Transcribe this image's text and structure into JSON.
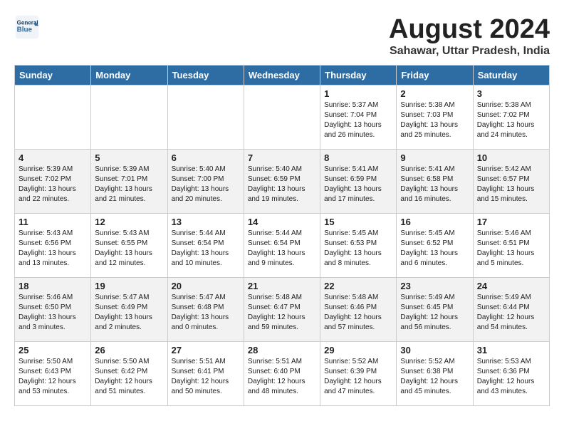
{
  "header": {
    "logo_line1": "General",
    "logo_line2": "Blue",
    "title": "August 2024",
    "subtitle": "Sahawar, Uttar Pradesh, India"
  },
  "days_of_week": [
    "Sunday",
    "Monday",
    "Tuesday",
    "Wednesday",
    "Thursday",
    "Friday",
    "Saturday"
  ],
  "weeks": [
    [
      {
        "day": "",
        "info": ""
      },
      {
        "day": "",
        "info": ""
      },
      {
        "day": "",
        "info": ""
      },
      {
        "day": "",
        "info": ""
      },
      {
        "day": "1",
        "info": "Sunrise: 5:37 AM\nSunset: 7:04 PM\nDaylight: 13 hours\nand 26 minutes."
      },
      {
        "day": "2",
        "info": "Sunrise: 5:38 AM\nSunset: 7:03 PM\nDaylight: 13 hours\nand 25 minutes."
      },
      {
        "day": "3",
        "info": "Sunrise: 5:38 AM\nSunset: 7:02 PM\nDaylight: 13 hours\nand 24 minutes."
      }
    ],
    [
      {
        "day": "4",
        "info": "Sunrise: 5:39 AM\nSunset: 7:02 PM\nDaylight: 13 hours\nand 22 minutes."
      },
      {
        "day": "5",
        "info": "Sunrise: 5:39 AM\nSunset: 7:01 PM\nDaylight: 13 hours\nand 21 minutes."
      },
      {
        "day": "6",
        "info": "Sunrise: 5:40 AM\nSunset: 7:00 PM\nDaylight: 13 hours\nand 20 minutes."
      },
      {
        "day": "7",
        "info": "Sunrise: 5:40 AM\nSunset: 6:59 PM\nDaylight: 13 hours\nand 19 minutes."
      },
      {
        "day": "8",
        "info": "Sunrise: 5:41 AM\nSunset: 6:59 PM\nDaylight: 13 hours\nand 17 minutes."
      },
      {
        "day": "9",
        "info": "Sunrise: 5:41 AM\nSunset: 6:58 PM\nDaylight: 13 hours\nand 16 minutes."
      },
      {
        "day": "10",
        "info": "Sunrise: 5:42 AM\nSunset: 6:57 PM\nDaylight: 13 hours\nand 15 minutes."
      }
    ],
    [
      {
        "day": "11",
        "info": "Sunrise: 5:43 AM\nSunset: 6:56 PM\nDaylight: 13 hours\nand 13 minutes."
      },
      {
        "day": "12",
        "info": "Sunrise: 5:43 AM\nSunset: 6:55 PM\nDaylight: 13 hours\nand 12 minutes."
      },
      {
        "day": "13",
        "info": "Sunrise: 5:44 AM\nSunset: 6:54 PM\nDaylight: 13 hours\nand 10 minutes."
      },
      {
        "day": "14",
        "info": "Sunrise: 5:44 AM\nSunset: 6:54 PM\nDaylight: 13 hours\nand 9 minutes."
      },
      {
        "day": "15",
        "info": "Sunrise: 5:45 AM\nSunset: 6:53 PM\nDaylight: 13 hours\nand 8 minutes."
      },
      {
        "day": "16",
        "info": "Sunrise: 5:45 AM\nSunset: 6:52 PM\nDaylight: 13 hours\nand 6 minutes."
      },
      {
        "day": "17",
        "info": "Sunrise: 5:46 AM\nSunset: 6:51 PM\nDaylight: 13 hours\nand 5 minutes."
      }
    ],
    [
      {
        "day": "18",
        "info": "Sunrise: 5:46 AM\nSunset: 6:50 PM\nDaylight: 13 hours\nand 3 minutes."
      },
      {
        "day": "19",
        "info": "Sunrise: 5:47 AM\nSunset: 6:49 PM\nDaylight: 13 hours\nand 2 minutes."
      },
      {
        "day": "20",
        "info": "Sunrise: 5:47 AM\nSunset: 6:48 PM\nDaylight: 13 hours\nand 0 minutes."
      },
      {
        "day": "21",
        "info": "Sunrise: 5:48 AM\nSunset: 6:47 PM\nDaylight: 12 hours\nand 59 minutes."
      },
      {
        "day": "22",
        "info": "Sunrise: 5:48 AM\nSunset: 6:46 PM\nDaylight: 12 hours\nand 57 minutes."
      },
      {
        "day": "23",
        "info": "Sunrise: 5:49 AM\nSunset: 6:45 PM\nDaylight: 12 hours\nand 56 minutes."
      },
      {
        "day": "24",
        "info": "Sunrise: 5:49 AM\nSunset: 6:44 PM\nDaylight: 12 hours\nand 54 minutes."
      }
    ],
    [
      {
        "day": "25",
        "info": "Sunrise: 5:50 AM\nSunset: 6:43 PM\nDaylight: 12 hours\nand 53 minutes."
      },
      {
        "day": "26",
        "info": "Sunrise: 5:50 AM\nSunset: 6:42 PM\nDaylight: 12 hours\nand 51 minutes."
      },
      {
        "day": "27",
        "info": "Sunrise: 5:51 AM\nSunset: 6:41 PM\nDaylight: 12 hours\nand 50 minutes."
      },
      {
        "day": "28",
        "info": "Sunrise: 5:51 AM\nSunset: 6:40 PM\nDaylight: 12 hours\nand 48 minutes."
      },
      {
        "day": "29",
        "info": "Sunrise: 5:52 AM\nSunset: 6:39 PM\nDaylight: 12 hours\nand 47 minutes."
      },
      {
        "day": "30",
        "info": "Sunrise: 5:52 AM\nSunset: 6:38 PM\nDaylight: 12 hours\nand 45 minutes."
      },
      {
        "day": "31",
        "info": "Sunrise: 5:53 AM\nSunset: 6:36 PM\nDaylight: 12 hours\nand 43 minutes."
      }
    ]
  ]
}
